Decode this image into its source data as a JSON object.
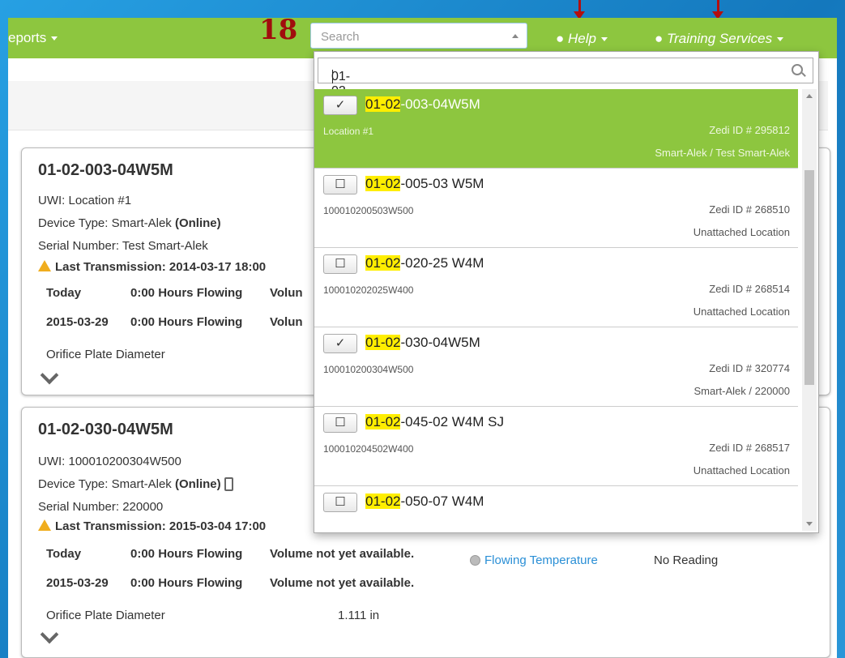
{
  "navbar": {
    "reports_label": "eports",
    "help_label": "Help",
    "training_label": "Training Services",
    "search_placeholder": "Search"
  },
  "annotation": {
    "step_number": "18"
  },
  "dropdown": {
    "query": "01-02",
    "match_prefix": "01-02",
    "results": [
      {
        "checked": true,
        "suffix": "-003-04W5M",
        "sub": "Location #1",
        "zedi_id": "Zedi ID # 295812",
        "owner": "Smart-Alek / Test Smart-Alek",
        "selected": true
      },
      {
        "checked": false,
        "suffix": "-005-03 W5M",
        "sub": "100010200503W500",
        "zedi_id": "Zedi ID # 268510",
        "owner": "Unattached Location",
        "selected": false
      },
      {
        "checked": false,
        "suffix": "-020-25 W4M",
        "sub": "100010202025W400",
        "zedi_id": "Zedi ID # 268514",
        "owner": "Unattached Location",
        "selected": false
      },
      {
        "checked": true,
        "suffix": "-030-04W5M",
        "sub": "100010200304W500",
        "zedi_id": "Zedi ID # 320774",
        "owner": "Smart-Alek / 220000",
        "selected": false
      },
      {
        "checked": false,
        "suffix": "-045-02 W4M SJ",
        "sub": "100010204502W400",
        "zedi_id": "Zedi ID # 268517",
        "owner": "Unattached Location",
        "selected": false
      },
      {
        "checked": false,
        "suffix": "-050-07 W4M",
        "sub": "",
        "zedi_id": "",
        "owner": "",
        "selected": false
      }
    ]
  },
  "cards": [
    {
      "title": "01-02-003-04W5M",
      "uwi": "UWI: Location #1",
      "device_prefix": "Device Type: Smart-Alek",
      "device_status": "(Online)",
      "serial": "Serial Number: Test Smart-Alek",
      "last_tx": "Last Transmission: 2014-03-17 18:00",
      "row1_date": "Today",
      "row1_flow": "0:00 Hours Flowing",
      "row1_vol": "Volun",
      "row2_date": "2015-03-29",
      "row2_flow": "0:00 Hours Flowing",
      "row2_vol": "Volun",
      "orifice_label": "Orifice Plate Diameter"
    },
    {
      "title": "01-02-030-04W5M",
      "uwi": "UWI: 100010200304W500",
      "device_prefix": "Device Type: Smart-Alek",
      "device_status": "(Online)",
      "serial": "Serial Number: 220000",
      "last_tx": "Last Transmission: 2015-03-04 17:00",
      "row1_date": "Today",
      "row1_flow": "0:00 Hours Flowing",
      "row1_vol": "Volume not yet available.",
      "row2_date": "2015-03-29",
      "row2_flow": "0:00 Hours Flowing",
      "row2_vol": "Volume not yet available.",
      "orifice_label": "Orifice Plate Diameter",
      "orifice_value": "1.111 in",
      "sensor_label": "Flowing Temperature",
      "sensor_value": "No Reading"
    }
  ]
}
